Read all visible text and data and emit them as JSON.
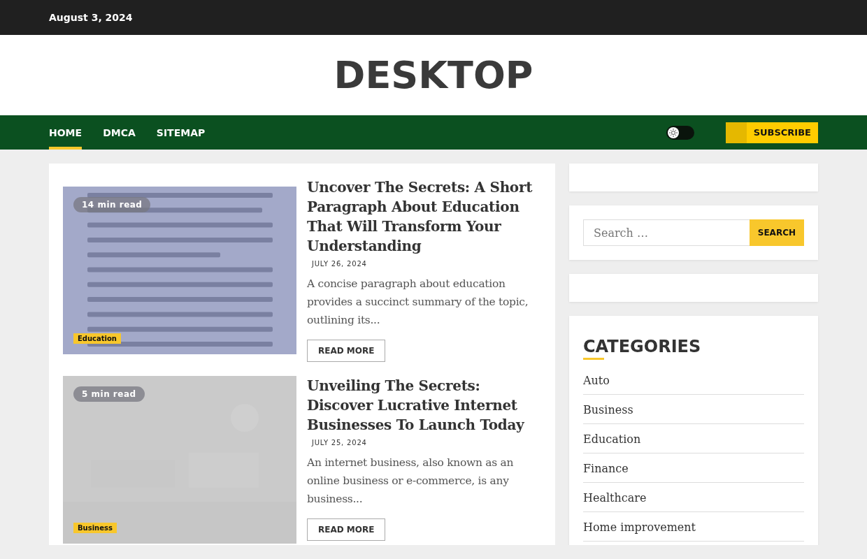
{
  "top_bar": {
    "date": "August 3, 2024"
  },
  "site_title": "DESKTOP",
  "nav": {
    "items": [
      {
        "label": "HOME",
        "selected": true
      },
      {
        "label": "DMCA",
        "selected": false
      },
      {
        "label": "SITEMAP",
        "selected": false
      }
    ],
    "dark_mode": false,
    "subscribe": "SUBSCRIBE"
  },
  "posts": [
    {
      "read_time": "14 min read",
      "category": "Education",
      "title": "Uncover The Secrets: A Short Paragraph About Education That Will Transform Your Understanding",
      "date": "JULY 26, 2024",
      "excerpt": "A concise paragraph about education provides a succinct summary of the topic, outlining its...",
      "button": "READ MORE"
    },
    {
      "read_time": "5 min read",
      "category": "Business",
      "title": "Unveiling The Secrets: Discover Lucrative Internet Businesses To Launch Today",
      "date": "JULY 25, 2024",
      "excerpt": "An internet business, also known as an online business or e-commerce, is any business...",
      "button": "READ MORE"
    }
  ],
  "sidebar": {
    "search": {
      "placeholder": "Search …",
      "button": "SEARCH"
    },
    "categories": {
      "title": "CATEGORIES",
      "items": [
        "Auto",
        "Business",
        "Education",
        "Finance",
        "Healthcare",
        "Home improvement"
      ]
    }
  }
}
